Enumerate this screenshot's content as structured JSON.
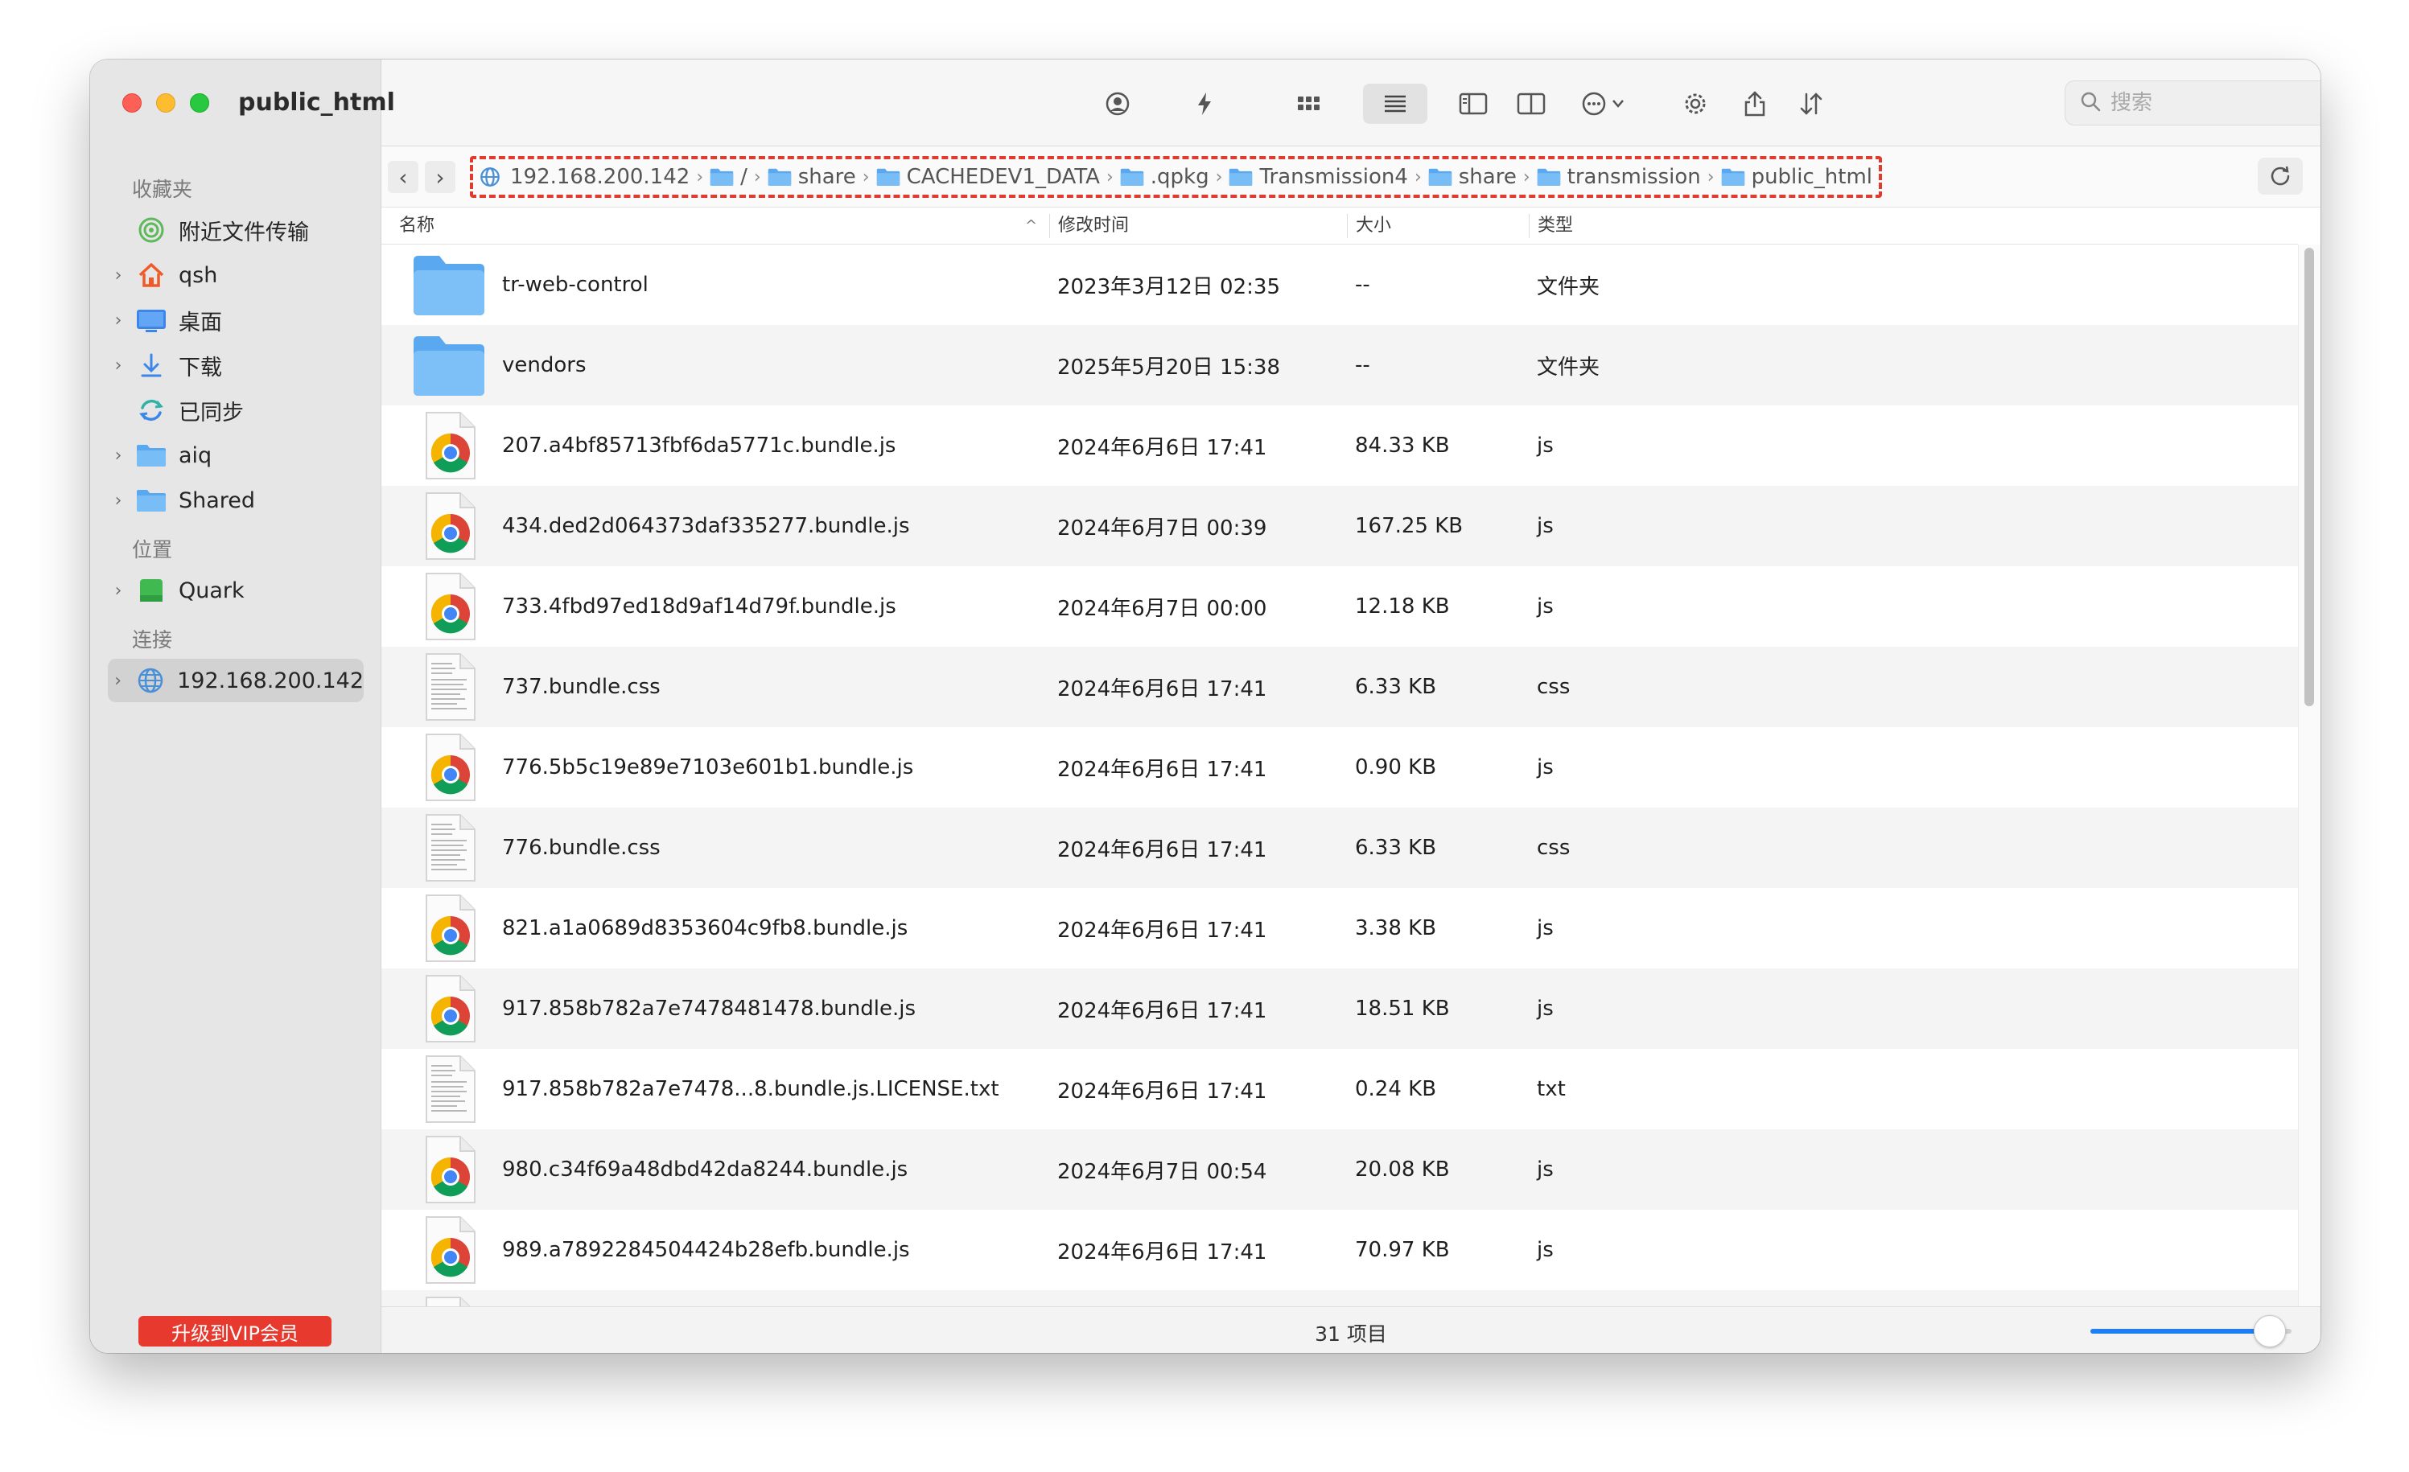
{
  "window": {
    "title": "public_html"
  },
  "search": {
    "placeholder": "搜索"
  },
  "sidebar": {
    "sections": {
      "favorites": "收藏夹",
      "locations": "位置",
      "connections": "连接"
    },
    "items": [
      {
        "label": "附近文件传输",
        "icon": "airdrop-icon",
        "chevron": false
      },
      {
        "label": "qsh",
        "icon": "home-icon",
        "chevron": true
      },
      {
        "label": "桌面",
        "icon": "desktop-icon",
        "chevron": true
      },
      {
        "label": "下载",
        "icon": "download-icon",
        "chevron": true
      },
      {
        "label": "已同步",
        "icon": "sync-icon",
        "chevron": false
      },
      {
        "label": "aiq",
        "icon": "folder-icon",
        "chevron": true
      },
      {
        "label": "Shared",
        "icon": "folder-icon",
        "chevron": true
      },
      {
        "label": "Quark",
        "icon": "drive-icon",
        "chevron": true
      },
      {
        "label": "192.168.200.142",
        "icon": "network-icon",
        "chevron": true,
        "selected": true
      }
    ],
    "vip_button": "升级到VIP会员"
  },
  "breadcrumb": [
    {
      "label": "192.168.200.142",
      "icon": "network-icon"
    },
    {
      "label": "/",
      "icon": "folder-icon"
    },
    {
      "label": "share",
      "icon": "folder-icon"
    },
    {
      "label": "CACHEDEV1_DATA",
      "icon": "folder-icon"
    },
    {
      "label": ".qpkg",
      "icon": "folder-icon"
    },
    {
      "label": "Transmission4",
      "icon": "folder-icon"
    },
    {
      "label": "share",
      "icon": "folder-icon"
    },
    {
      "label": "transmission",
      "icon": "folder-icon"
    },
    {
      "label": "public_html",
      "icon": "folder-icon"
    }
  ],
  "columns": {
    "name": "名称",
    "modified": "修改时间",
    "size": "大小",
    "kind": "类型"
  },
  "files": [
    {
      "name": "tr-web-control",
      "modified": "2023年3月12日 02:35",
      "size": "--",
      "kind": "文件夹",
      "icon": "folder-icon"
    },
    {
      "name": "vendors",
      "modified": "2025年5月20日 15:38",
      "size": "--",
      "kind": "文件夹",
      "icon": "folder-icon"
    },
    {
      "name": "207.a4bf85713fbf6da5771c.bundle.js",
      "modified": "2024年6月6日 17:41",
      "size": "84.33 KB",
      "kind": "js",
      "icon": "chrome-icon"
    },
    {
      "name": "434.ded2d064373daf335277.bundle.js",
      "modified": "2024年6月7日 00:39",
      "size": "167.25 KB",
      "kind": "js",
      "icon": "chrome-icon"
    },
    {
      "name": "733.4fbd97ed18d9af14d79f.bundle.js",
      "modified": "2024年6月7日 00:00",
      "size": "12.18 KB",
      "kind": "js",
      "icon": "chrome-icon"
    },
    {
      "name": "737.bundle.css",
      "modified": "2024年6月6日 17:41",
      "size": "6.33 KB",
      "kind": "css",
      "icon": "document-icon"
    },
    {
      "name": "776.5b5c19e89e7103e601b1.bundle.js",
      "modified": "2024年6月6日 17:41",
      "size": "0.90 KB",
      "kind": "js",
      "icon": "chrome-icon"
    },
    {
      "name": "776.bundle.css",
      "modified": "2024年6月6日 17:41",
      "size": "6.33 KB",
      "kind": "css",
      "icon": "document-icon"
    },
    {
      "name": "821.a1a0689d8353604c9fb8.bundle.js",
      "modified": "2024年6月6日 17:41",
      "size": "3.38 KB",
      "kind": "js",
      "icon": "chrome-icon"
    },
    {
      "name": "917.858b782a7e7478481478.bundle.js",
      "modified": "2024年6月6日 17:41",
      "size": "18.51 KB",
      "kind": "js",
      "icon": "chrome-icon"
    },
    {
      "name": "917.858b782a7e7478...8.bundle.js.LICENSE.txt",
      "modified": "2024年6月6日 17:41",
      "size": "0.24 KB",
      "kind": "txt",
      "icon": "document-icon"
    },
    {
      "name": "980.c34f69a48dbd42da8244.bundle.js",
      "modified": "2024年6月7日 00:54",
      "size": "20.08 KB",
      "kind": "js",
      "icon": "chrome-icon"
    },
    {
      "name": "989.a7892284504424b28efb.bundle.js",
      "modified": "2024年6月6日 17:41",
      "size": "70.97 KB",
      "kind": "js",
      "icon": "chrome-icon"
    }
  ],
  "status": {
    "item_count": "31 项目",
    "zoom_level": 0.85
  },
  "colors": {
    "accent": "#1e7ef2",
    "highlight": "#e23a2c",
    "vip": "#e8392f"
  }
}
